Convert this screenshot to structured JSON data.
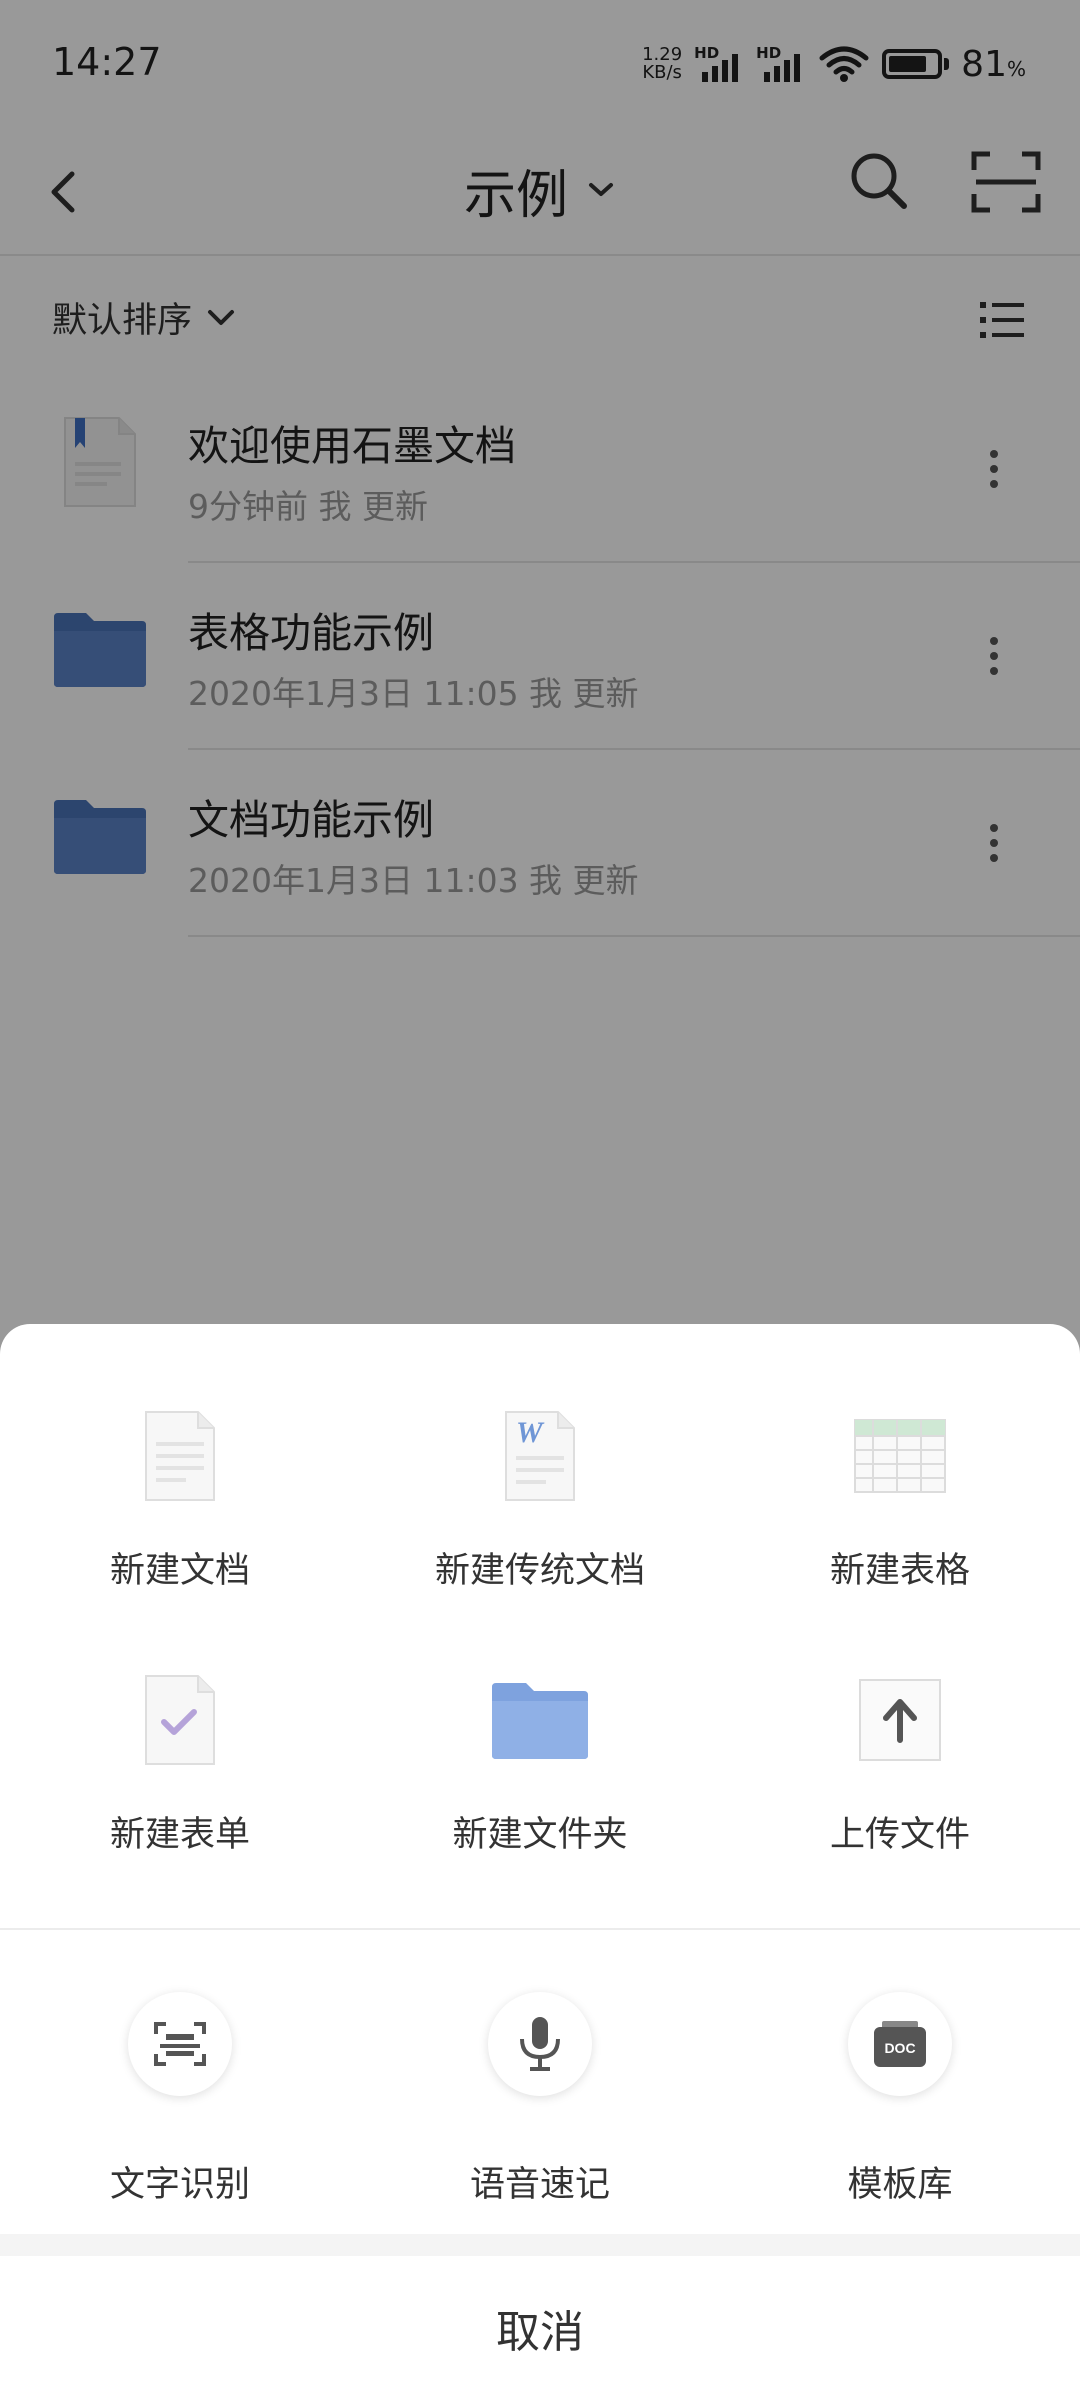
{
  "status_bar": {
    "time": "14:27",
    "net_speed_value": "1.29",
    "net_speed_unit": "KB/s",
    "sim1_label": "HD",
    "sim2_label": "HD",
    "battery_percent": "81",
    "battery_unit": "%"
  },
  "topbar": {
    "title": "示例"
  },
  "sort": {
    "label": "默认排序"
  },
  "files": [
    {
      "name": "欢迎使用石墨文档",
      "meta": "9分钟前 我 更新",
      "icon": "document-icon"
    },
    {
      "name": "表格功能示例",
      "meta": "2020年1月3日 11:05 我 更新",
      "icon": "folder-icon"
    },
    {
      "name": "文档功能示例",
      "meta": "2020年1月3日 11:03 我 更新",
      "icon": "folder-icon"
    }
  ],
  "sheet": {
    "create_items": [
      {
        "label": "新建文档",
        "icon": "new-doc-icon"
      },
      {
        "label": "新建传统文档",
        "icon": "word-doc-icon"
      },
      {
        "label": "新建表格",
        "icon": "spreadsheet-icon"
      },
      {
        "label": "新建表单",
        "icon": "form-icon"
      },
      {
        "label": "新建文件夹",
        "icon": "folder-icon"
      },
      {
        "label": "上传文件",
        "icon": "upload-icon"
      }
    ],
    "tools": [
      {
        "label": "文字识别",
        "icon": "ocr-scan-icon"
      },
      {
        "label": "语音速记",
        "icon": "microphone-icon"
      },
      {
        "label": "模板库",
        "icon": "template-doc-icon"
      }
    ],
    "template_badge": "DOC",
    "word_letter": "W",
    "cancel_label": "取消"
  },
  "colors": {
    "folder_dark": "#4a73b8",
    "folder_light": "#8fb0e6",
    "overlay": "rgba(0,0,0,0.40)",
    "sheet_bg": "#ffffff",
    "form_check": "#b5a3d9",
    "sheet_green": "#cfe8d4"
  }
}
